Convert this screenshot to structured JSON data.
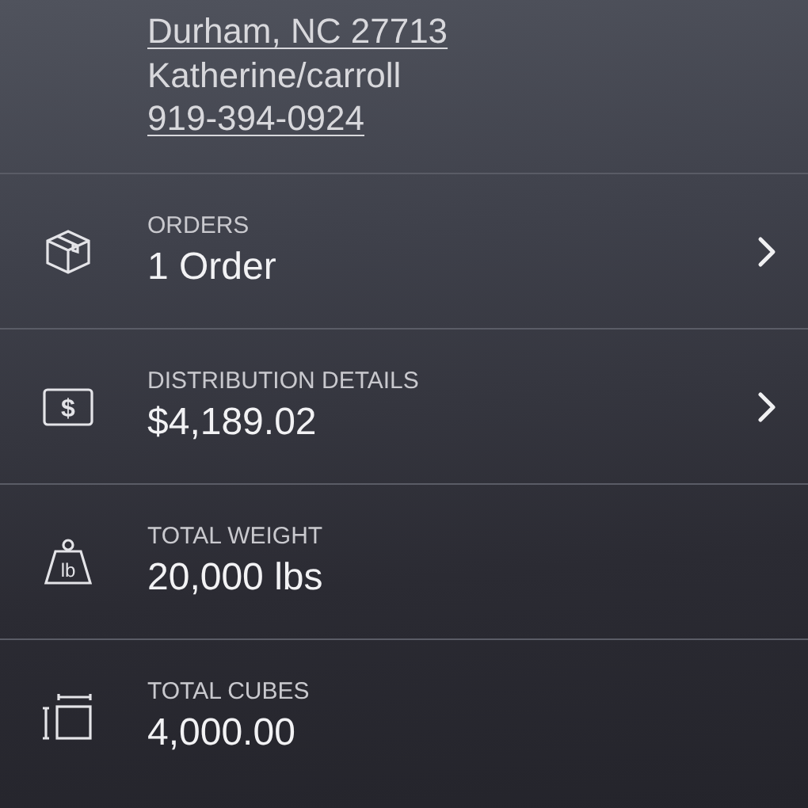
{
  "contact": {
    "city_line": "Durham, NC 27713",
    "name": "Katherine/carroll",
    "phone": "919-394-0924"
  },
  "rows": [
    {
      "kind": "box",
      "label": "ORDERS",
      "value": "1 Order",
      "navigable": true
    },
    {
      "kind": "dollar",
      "icon_text": "$",
      "label": "DISTRIBUTION DETAILS",
      "value": "$4,189.02",
      "navigable": true
    },
    {
      "kind": "weight",
      "icon_text": "lb",
      "label": "TOTAL WEIGHT",
      "value": "20,000 lbs",
      "navigable": false
    },
    {
      "kind": "cubes",
      "label": "TOTAL CUBES",
      "value": "4,000.00",
      "navigable": false
    }
  ]
}
